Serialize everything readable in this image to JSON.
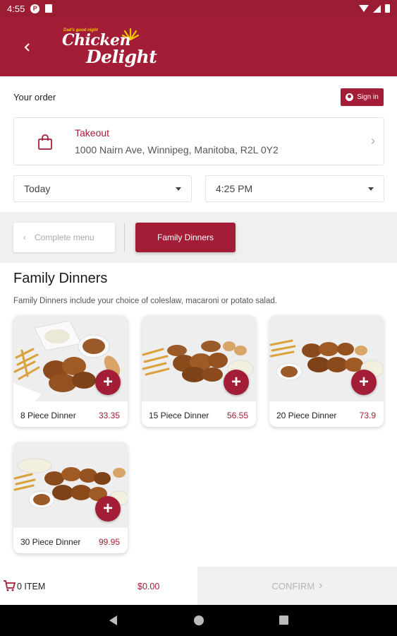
{
  "status_bar": {
    "time": "4:55",
    "badge": "P"
  },
  "header": {
    "logo_tagline": "Dad's good night",
    "logo_line1": "Chicken",
    "logo_line2": "Delight"
  },
  "order": {
    "label": "Your order",
    "sign_in_label": "Sign in",
    "mode": "Takeout",
    "address": "1000 Nairn Ave, Winnipeg, Manitoba, R2L 0Y2",
    "date_value": "Today",
    "time_value": "4:25 PM"
  },
  "categories": {
    "back_label": "Complete menu",
    "active_label": "Family Dinners"
  },
  "section": {
    "title": "Family Dinners",
    "description": "Family Dinners include your choice of coleslaw, macaroni or potato salad."
  },
  "products": [
    {
      "name": "8 Piece Dinner",
      "price": "33.35"
    },
    {
      "name": "15 Piece Dinner",
      "price": "56.55"
    },
    {
      "name": "20 Piece Dinner",
      "price": "73.9"
    },
    {
      "name": "30 Piece Dinner",
      "price": "99.95"
    }
  ],
  "cart": {
    "count_label": "0 ITEM",
    "total": "$0.00",
    "confirm_label": "CONFIRM"
  },
  "colors": {
    "brand": "#a31d36",
    "logo_accent": "#f5c400"
  },
  "icons": [
    "back-arrow-icon",
    "user-icon",
    "shopping-bag-icon",
    "chevron-right-icon",
    "caret-down-icon",
    "chevron-left-icon",
    "plus-icon",
    "cart-icon",
    "wifi-icon",
    "signal-icon",
    "battery-icon"
  ]
}
